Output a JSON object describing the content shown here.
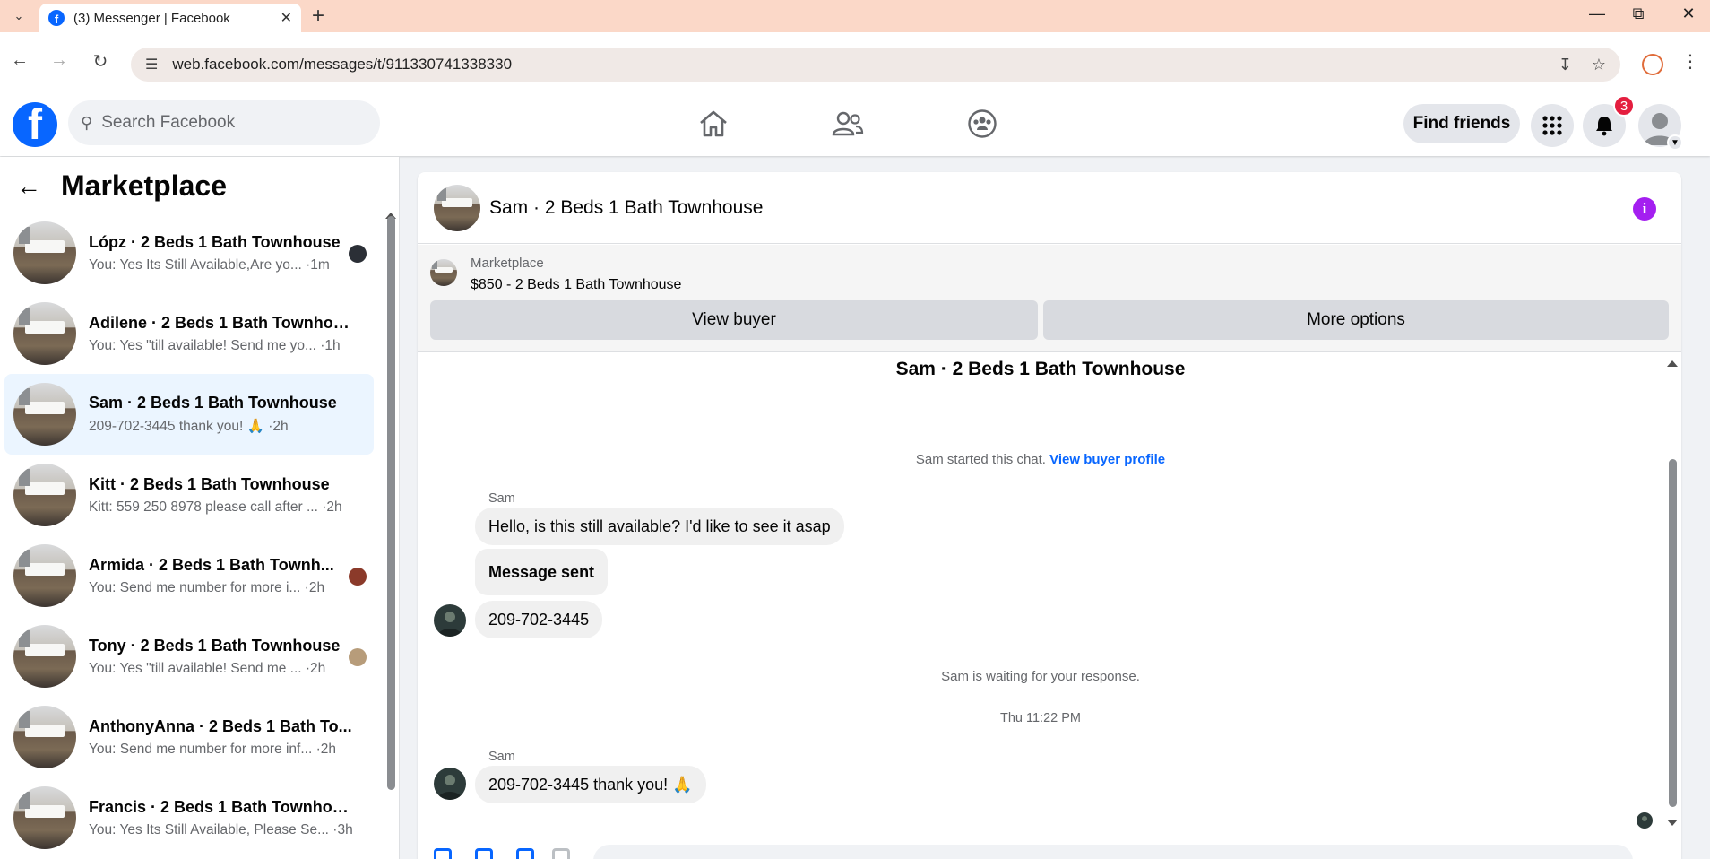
{
  "browser": {
    "tab_title": "(3) Messenger | Facebook",
    "url": "web.facebook.com/messages/t/911330741338330"
  },
  "fb_header": {
    "search_placeholder": "Search Facebook",
    "find_friends_label": "Find friends",
    "notification_count": "3"
  },
  "left_panel": {
    "title": "Marketplace",
    "conversations": [
      {
        "name": "Lópz · 2 Beds 1 Bath Townhouse",
        "preview": "You: Yes Its Still Available,Are yo... ·1m"
      },
      {
        "name": "Adilene · 2 Beds 1 Bath Townhou...",
        "preview": "You: Yes \"till available! Send me yo... ·1h"
      },
      {
        "name": "Sam · 2 Beds 1 Bath Townhouse",
        "preview": "209-702-3445 thank you! 🙏 ·2h"
      },
      {
        "name": "Kitt · 2 Beds 1 Bath Townhouse",
        "preview": "Kitt: 559 250 8978 please call after ... ·2h"
      },
      {
        "name": "Armida · 2 Beds 1 Bath Townh...",
        "preview": "You: Send me number for more i... ·2h"
      },
      {
        "name": "Tony · 2 Beds 1 Bath Townhouse",
        "preview": "You: Yes \"till available! Send me ... ·2h"
      },
      {
        "name": "AnthonyAnna · 2 Beds 1 Bath To...",
        "preview": "You: Send me number for more inf... ·2h"
      },
      {
        "name": "Francis · 2 Beds 1 Bath Townhouse",
        "preview": "You: Yes Its Still Available, Please Se... ·3h"
      }
    ]
  },
  "chat": {
    "title": "Sam · 2 Beds 1 Bath Townhouse",
    "listing": {
      "source": "Marketplace",
      "title": "$850 - 2 Beds 1 Bath Townhouse",
      "view_buyer_label": "View buyer",
      "more_options_label": "More options"
    },
    "thread_title": "Sam · 2 Beds 1 Bath Townhouse",
    "started_text": "Sam started this chat.",
    "view_buyer_profile": "View buyer profile",
    "messages": [
      {
        "sender": "Sam",
        "text": "Hello, is this still available? I'd like to see it asap"
      },
      {
        "text": "Message sent"
      },
      {
        "text": "209-702-3445"
      }
    ],
    "waiting_text": "Sam is waiting for your response.",
    "timestamp": "Thu 11:22 PM",
    "last_message": {
      "sender": "Sam",
      "text": "209-702-3445 thank you! 🙏"
    }
  },
  "colors": {
    "brand": "#0866ff",
    "active_conv": "#ebf5ff",
    "info_icon": "#a41ff0",
    "badge": "#e41e3f"
  }
}
